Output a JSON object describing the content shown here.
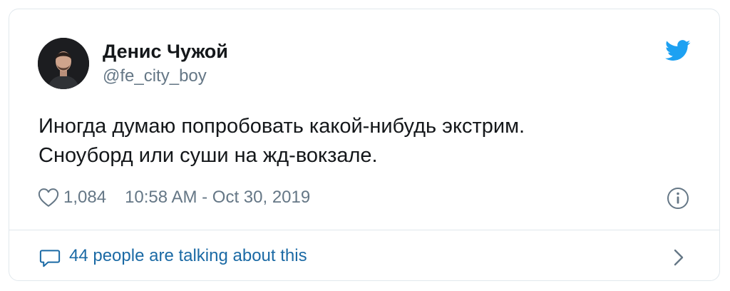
{
  "tweet": {
    "author_name": "Денис Чужой",
    "author_handle": "@fe_city_boy",
    "text_lines": [
      "Иногда думаю попробовать какой-нибудь экстрим.",
      "Сноуборд или суши на жд-вокзале."
    ],
    "likes": "1,084",
    "timestamp": "10:58 AM - Oct 30, 2019"
  },
  "footer": {
    "conversation_text": "44 people are talking about this"
  },
  "icons": {
    "brand": "twitter-bird-icon",
    "like": "heart-icon",
    "info": "info-icon",
    "reply": "speech-bubble-icon",
    "navigate": "chevron-right-icon"
  },
  "colors": {
    "twitter_blue": "#1da1f2",
    "link_blue": "#1b6aa5",
    "secondary_text": "#657786",
    "primary_text": "#14171a",
    "border": "#e1e8ed"
  }
}
